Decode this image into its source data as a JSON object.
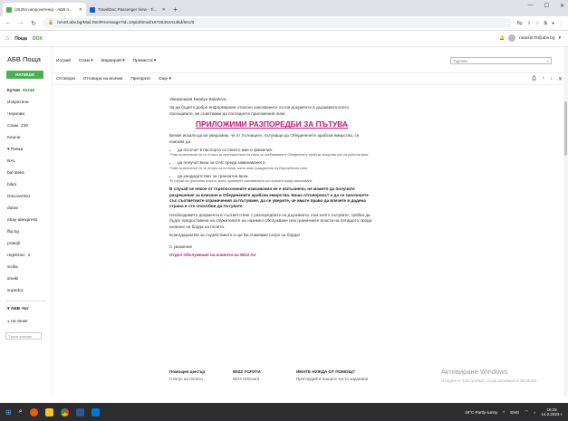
{
  "browser": {
    "tabs": [
      {
        "label": "(26254 непрочетени) - АБВ п...",
        "favicon_color": "#4caf50",
        "active": true
      },
      {
        "label": "TravelDoc Passenger View - Ti...",
        "favicon_color": "#1565c0",
        "active": false
      }
    ],
    "new_tab": "+",
    "url": "nm40.abv.bg/Mail.html#message?id=10pid/0mid/18706452413lid/60c/0",
    "profile_label": "Bg"
  },
  "header": {
    "mail_link": "Поща",
    "dox_link": "DOX",
    "username": "natalits78@abv.bg"
  },
  "sidebar": {
    "brand": "АБВ Поща",
    "compose_label": "НАПИШИ",
    "folders": [
      {
        "label": "Кутия",
        "count": "26248",
        "bold": true
      },
      {
        "label": "Изпратени",
        "count": ""
      },
      {
        "label": "Чернови",
        "count": ""
      },
      {
        "label": "Спам",
        "count": "236"
      },
      {
        "label": "Кошче",
        "count": ""
      },
      {
        "label": "Папки",
        "count": "",
        "expander": "▾"
      },
      {
        "label": "BAL",
        "count": ""
      },
      {
        "label": "bal aleks",
        "count": ""
      },
      {
        "label": "bileti",
        "count": ""
      },
      {
        "label": "DiscoverEU",
        "count": ""
      },
      {
        "label": "dubai",
        "count": ""
      },
      {
        "label": "ebay aliexpress",
        "count": ""
      },
      {
        "label": "flip.bg",
        "count": ""
      },
      {
        "label": "pratejli",
        "count": ""
      },
      {
        "label": "registraci",
        "count": "3"
      },
      {
        "label": "sicilia",
        "count": ""
      },
      {
        "label": "sneiki",
        "count": ""
      },
      {
        "label": "supedoc",
        "count": ""
      }
    ],
    "chat_title": "АБВ Чат",
    "chat_status": "На линия",
    "chat_search_placeholder": "Търси контакт"
  },
  "toolbar": {
    "items": [
      "Изтрий",
      "Спам ▾",
      "Маркирай ▾",
      "Премести ▾"
    ],
    "search_placeholder": "Търсене",
    "actions": [
      "Отговори",
      "Отговори на всички",
      "Препрати",
      "Още ▾"
    ]
  },
  "message": {
    "greeting": "Уважаема/и Natalya Bakalova,",
    "intro": "За да бъдете добре информирани относно изискваните пътни документи в държавата която посещавате, ви съветваме да погледнете приложения линк:",
    "banner": "ПРИЛОЖИМИ РАЗПОРЕДБИ ЗА ПЪТУВА",
    "p2": "Бихме искали да ви уведомим, че от пътниците, пътуващи до Обединените арабски емирства, се изисква да:",
    "bullet1": "да посочат в паспорта си своето име и фамилия.",
    "note1": "*Това ограничение не се отнася за притежателите на карта за пребиваване в Обединените арабски емирства или на работна виза.",
    "bullet2": "да получат виза за ОАЕ преди заминаването.",
    "note2": "*Това ограничение не се отнася за пътници, които имат гражданство на Европейския съюз.",
    "bullet3": "да кандидатстват за транзитна виза.",
    "note3": "*В случай на транзитни полети, моля, проверете изискванията за страната преди заминаване.",
    "bold_block": "В случай че някое от горепосочените изисквания не е изпълнено, не можете да получите разрешение за влизане в Обединените арабски емирства. Ваша отговорност е да се запознаете със съответните ограничения за пътуване, да се уверите, че имате право да влезете в дадена страна и сте способни да пътувате.",
    "p3": "Необходимите документи в съответствие с разпоредбите на държавата, към която пътувате, трябва да бъдат предоставени на служителите на наземно обслужване или граничните власти на летището преди качване на борда на полета.",
    "thanks": "Благодарим Ви за съдействието и ще Ви очакваме скоро на борда!",
    "regards": "С уважение",
    "signature": "Отдел Обслужване на клиенти на Wizz Air"
  },
  "footer": {
    "col1_title": "Помощен център",
    "col1_item": "Статус на полета",
    "col2_title": "WIZZ УСЛУГИ",
    "col2_item": "Wizz Discount",
    "col3_title": "ИМАТЕ НУЖДА ОТ ПОМОЩ?",
    "col3_item": "Прегледайте нашите често задавани"
  },
  "watermark": {
    "title": "Активиране Windows",
    "subtitle": "Отидете в \"Настройки\", за да активирате Windows."
  },
  "taskbar": {
    "weather": "19°C  Partly sunny",
    "lang": "ENG",
    "time": "16:22",
    "date": "14.3.2023 г."
  },
  "colors": {
    "accent_green": "#4caf50",
    "banner_magenta": "#c2187a"
  }
}
